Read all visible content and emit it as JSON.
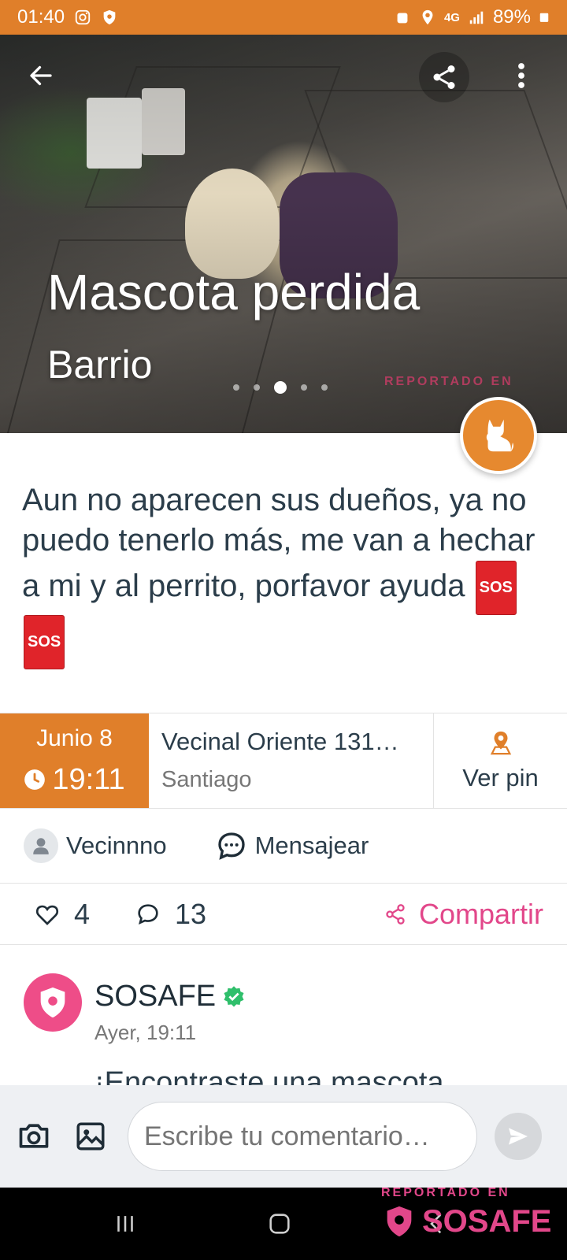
{
  "status_bar": {
    "time": "01:40",
    "battery": "89%",
    "network": "4G"
  },
  "hero": {
    "title": "Mascota perdida",
    "subtitle": "Barrio",
    "carousel_total": 5,
    "carousel_active": 3,
    "watermark": "REPORTADO EN"
  },
  "post": {
    "description": "Aun no aparecen sus dueños, ya no puedo tenerlo más, me van a hechar a mi y al perrito, porfavor ayuda",
    "emoji_sos": "SOS"
  },
  "info": {
    "date": "Junio 8",
    "time": "19:11",
    "address": "Vecinal Oriente  131…",
    "city": "Santiago",
    "pin_label": "Ver pin"
  },
  "author": {
    "name": "Vecinnno",
    "message_label": "Mensajear"
  },
  "stats": {
    "likes": "4",
    "comments": "13",
    "share_label": "Compartir"
  },
  "comment": {
    "author": "SOSAFE",
    "time": "Ayer, 19:11",
    "text": "¡Encontraste una mascota"
  },
  "composer": {
    "placeholder": "Escribe tu comentario…"
  },
  "watermark": {
    "label": "REPORTADO EN",
    "brand": "SOSAFE"
  },
  "colors": {
    "accent": "#e07f2a",
    "brand_pink": "#e2478a",
    "text": "#2b3d4a"
  }
}
